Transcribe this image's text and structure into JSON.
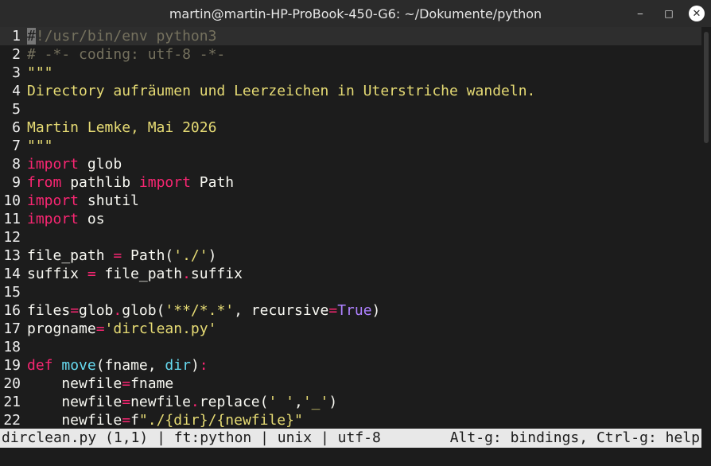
{
  "window": {
    "title": "martin@martin-HP-ProBook-450-G6: ~/Dokumente/python",
    "controls": {
      "minimize": "‒",
      "maximize": "□",
      "close": "✕"
    }
  },
  "colors": {
    "background": "#1c1c1c",
    "comment": "#75715e",
    "string": "#e6db74",
    "keyword": "#f92672",
    "constant": "#ae81ff",
    "function": "#66d9ef",
    "statusbar_bg": "#e8e8e8"
  },
  "editor": {
    "cursor_line": 1,
    "lines": [
      {
        "num": "1",
        "current": true,
        "tokens": [
          [
            "cursor",
            "#"
          ],
          [
            "comment",
            "!/usr/bin/env python3"
          ]
        ]
      },
      {
        "num": "2",
        "tokens": [
          [
            "comment",
            "# -*- coding: utf-8 -*-"
          ]
        ]
      },
      {
        "num": "3",
        "tokens": [
          [
            "string",
            "\"\"\""
          ]
        ]
      },
      {
        "num": "4",
        "tokens": [
          [
            "string",
            "Directory aufräumen und Leerzeichen in Uterstriche wandeln."
          ]
        ]
      },
      {
        "num": "5",
        "tokens": []
      },
      {
        "num": "6",
        "tokens": [
          [
            "string",
            "Martin Lemke, Mai 2026"
          ]
        ]
      },
      {
        "num": "7",
        "tokens": [
          [
            "string",
            "\"\"\""
          ]
        ]
      },
      {
        "num": "8",
        "tokens": [
          [
            "keyword",
            "import"
          ],
          [
            "plain",
            " glob"
          ]
        ]
      },
      {
        "num": "9",
        "tokens": [
          [
            "keyword",
            "from"
          ],
          [
            "plain",
            " pathlib "
          ],
          [
            "keyword",
            "import"
          ],
          [
            "plain",
            " Path"
          ]
        ]
      },
      {
        "num": "10",
        "tokens": [
          [
            "keyword",
            "import"
          ],
          [
            "plain",
            " shutil"
          ]
        ]
      },
      {
        "num": "11",
        "tokens": [
          [
            "keyword",
            "import"
          ],
          [
            "plain",
            " os"
          ]
        ]
      },
      {
        "num": "12",
        "tokens": []
      },
      {
        "num": "13",
        "tokens": [
          [
            "plain",
            "file_path "
          ],
          [
            "operator",
            "="
          ],
          [
            "plain",
            " Path("
          ],
          [
            "string",
            "'./'"
          ],
          [
            "plain",
            ")"
          ]
        ]
      },
      {
        "num": "14",
        "tokens": [
          [
            "plain",
            "suffix "
          ],
          [
            "operator",
            "="
          ],
          [
            "plain",
            " file_path"
          ],
          [
            "operator",
            "."
          ],
          [
            "plain",
            "suffix"
          ]
        ]
      },
      {
        "num": "15",
        "tokens": []
      },
      {
        "num": "16",
        "tokens": [
          [
            "plain",
            "files"
          ],
          [
            "operator",
            "="
          ],
          [
            "plain",
            "glob"
          ],
          [
            "operator",
            "."
          ],
          [
            "plain",
            "glob("
          ],
          [
            "string",
            "'**/*.*'"
          ],
          [
            "plain",
            ", recursive"
          ],
          [
            "operator",
            "="
          ],
          [
            "const",
            "True"
          ],
          [
            "plain",
            ")"
          ]
        ]
      },
      {
        "num": "17",
        "tokens": [
          [
            "plain",
            "progname"
          ],
          [
            "operator",
            "="
          ],
          [
            "string",
            "'dirclean.py'"
          ]
        ]
      },
      {
        "num": "18",
        "tokens": []
      },
      {
        "num": "19",
        "tokens": [
          [
            "keyword",
            "def"
          ],
          [
            "plain",
            " "
          ],
          [
            "func",
            "move"
          ],
          [
            "plain",
            "(fname, "
          ],
          [
            "param",
            "dir"
          ],
          [
            "plain",
            ")"
          ],
          [
            "operator",
            ":"
          ]
        ]
      },
      {
        "num": "20",
        "tokens": [
          [
            "plain",
            "    newfile"
          ],
          [
            "operator",
            "="
          ],
          [
            "plain",
            "fname"
          ]
        ]
      },
      {
        "num": "21",
        "tokens": [
          [
            "plain",
            "    newfile"
          ],
          [
            "operator",
            "="
          ],
          [
            "plain",
            "newfile"
          ],
          [
            "operator",
            "."
          ],
          [
            "plain",
            "replace("
          ],
          [
            "string",
            "' '"
          ],
          [
            "plain",
            ","
          ],
          [
            "string",
            "'_'"
          ],
          [
            "plain",
            ")"
          ]
        ]
      },
      {
        "num": "22",
        "tokens": [
          [
            "plain",
            "    newfile"
          ],
          [
            "operator",
            "="
          ],
          [
            "plain",
            "f"
          ],
          [
            "string",
            "\"./{dir}/{newfile}\""
          ]
        ]
      }
    ]
  },
  "statusbar": {
    "left": "dirclean.py (1,1) | ft:python | unix | utf-8",
    "right": "Alt-g: bindings, Ctrl-g: help"
  }
}
